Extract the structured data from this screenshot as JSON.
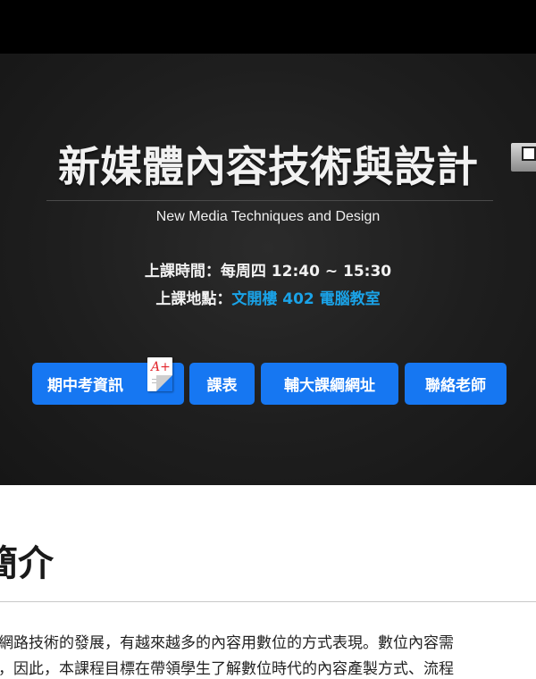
{
  "hero": {
    "title": "新媒體內容技術與設計",
    "subtitle": "New Media Techniques and Design",
    "time_label": "上課時間：",
    "time_value": "每周四 12:40 ~ 15:30",
    "place_label": "上課地點：",
    "place_value": "文開樓 402 電腦教室"
  },
  "buttons": {
    "exam": "期中考資訊",
    "exam_icon_text": "A+",
    "schedule": "課表",
    "fju": "輔大課綱網址",
    "contact": "聯絡老師"
  },
  "intro": {
    "heading": "簡介",
    "line1": "網路技術的發展，有越來越多的內容用數位的方式表現。數位內容需",
    "line2": "，因此，本課程目標在帶領學生了解數位時代的內容產製方式、流程"
  },
  "colors": {
    "accent": "#1aa3e8",
    "button": "#1677f2",
    "topbar": "#000000",
    "hero_bg": "#1e1e1e"
  },
  "icons": {
    "grade": "grade-paper-icon",
    "corner": "film-camera-icon"
  }
}
